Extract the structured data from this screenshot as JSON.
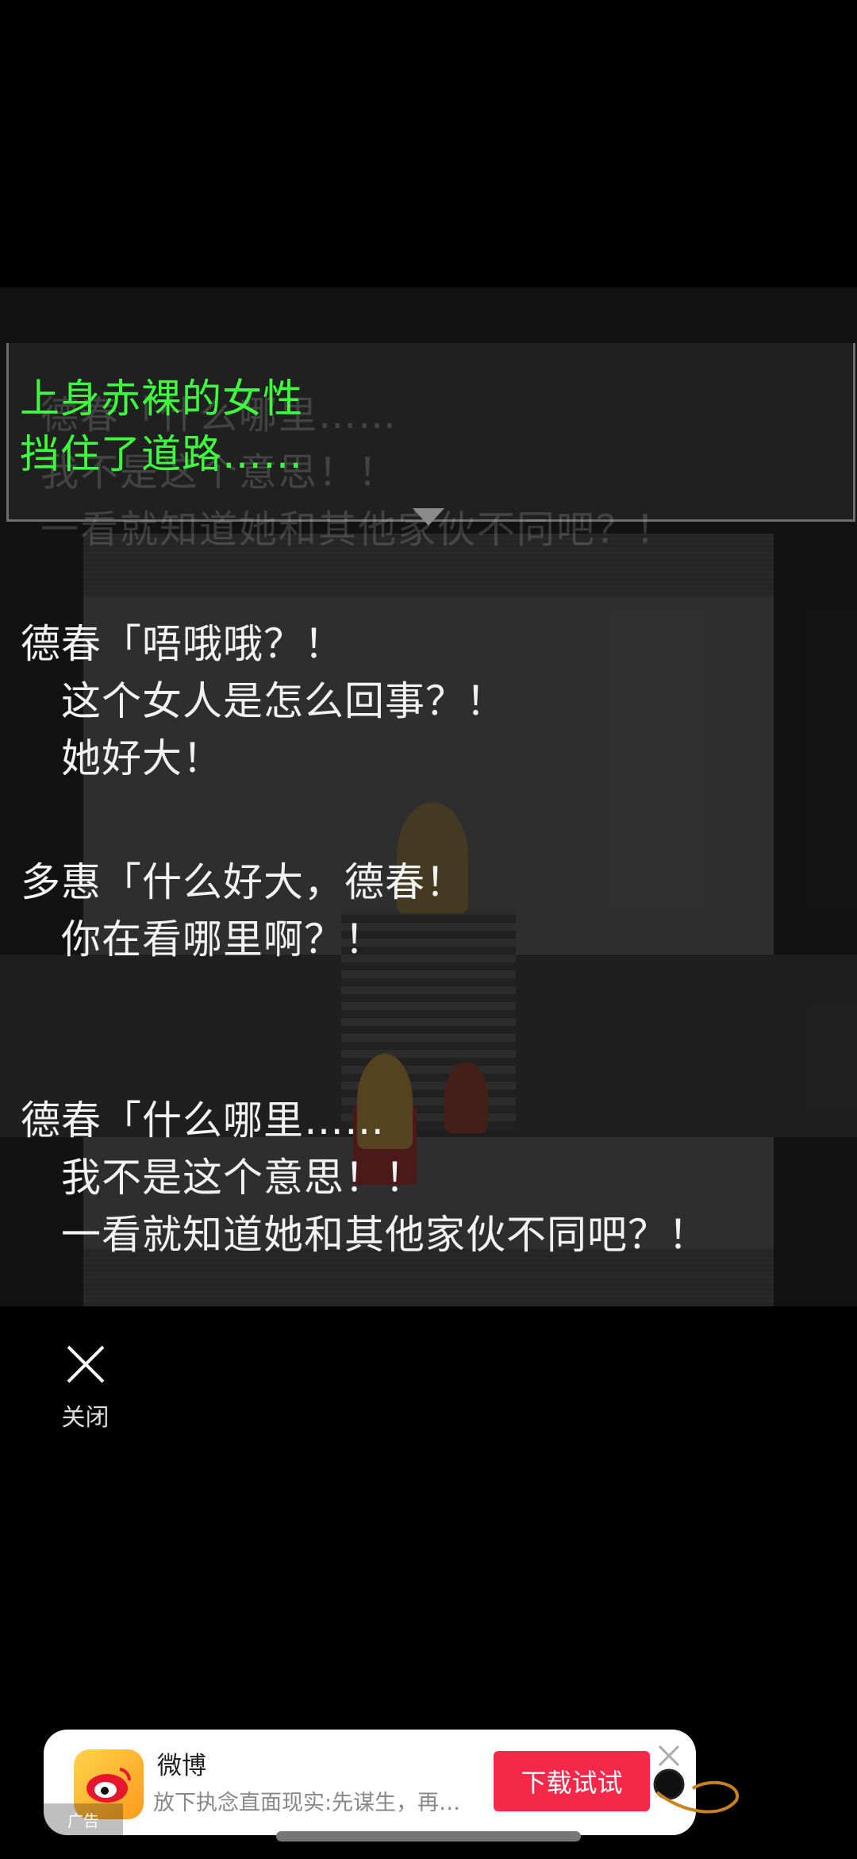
{
  "scene": {
    "ghost_lines": [
      "德春「什么哪里……",
      "我不是这个意思！！",
      "一看就知道她和其他家伙不同吧？！"
    ],
    "narration_lines": [
      "上身赤裸的女性",
      "挡住了道路……"
    ],
    "dialogue": [
      {
        "lines": [
          "德春「唔哦哦？！",
          "　这个女人是怎么回事？！",
          "　她好大！"
        ]
      },
      {
        "lines": [
          "多惠「什么好大，德春！",
          "　你在看哪里啊？！"
        ]
      },
      {
        "lines": [
          "德春「什么哪里……",
          "　我不是这个意思！！",
          "　一看就知道她和其他家伙不同吧？！"
        ]
      }
    ]
  },
  "close": {
    "label": "关闭",
    "icon": "close-x-icon"
  },
  "ad": {
    "app_name": "微博",
    "description": "放下执念直面现实:先谋生，再…",
    "cta_label": "下载试试",
    "badge": "广告",
    "cta_color": "#f5284a",
    "logo_icon": "weibo-logo-icon"
  }
}
